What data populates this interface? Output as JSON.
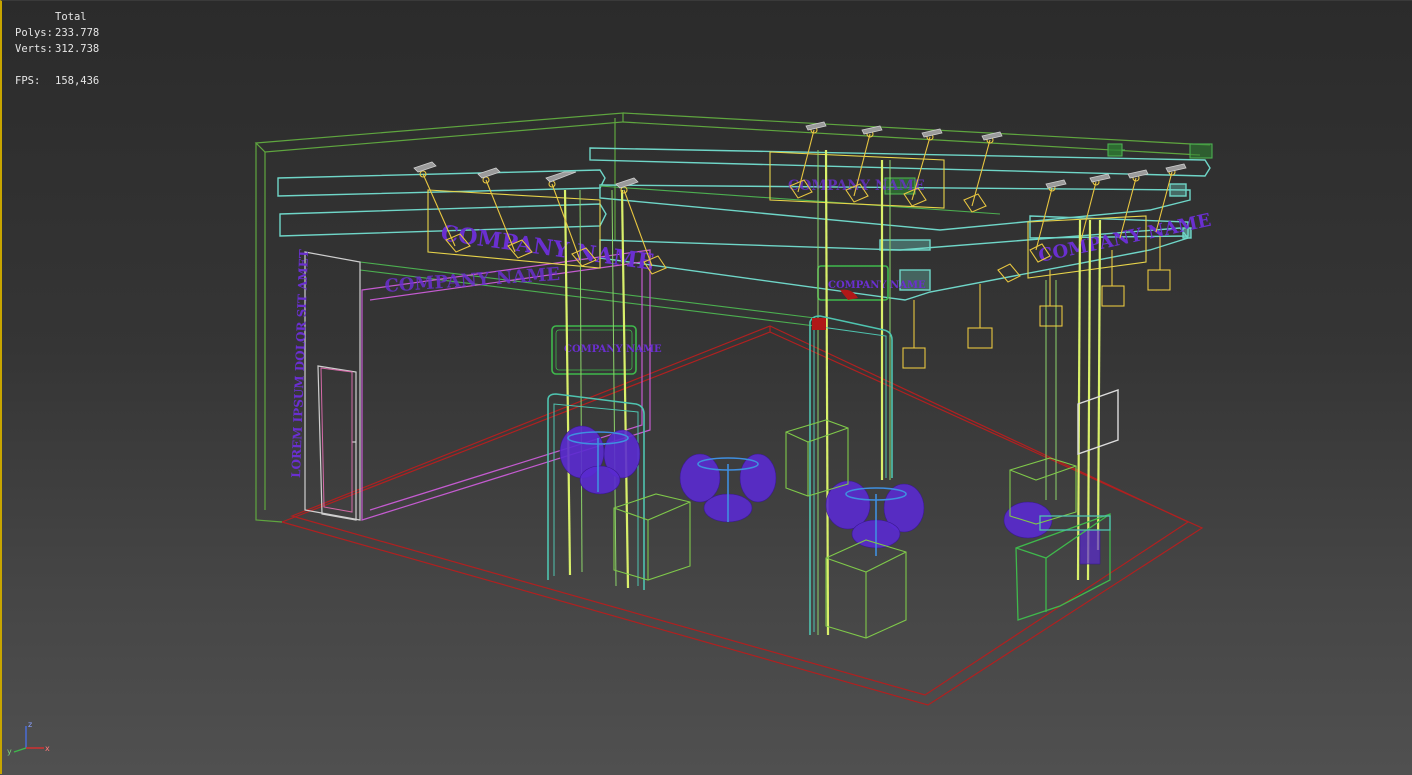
{
  "stats": {
    "header": "Total",
    "polys_label": "Polys:",
    "polys_value": "233.778",
    "verts_label": "Verts:",
    "verts_value": "312.738",
    "fps_label": "FPS:",
    "fps_value": "158,436"
  },
  "scene": {
    "sign_main": "COMPANY NAME",
    "sign_main_2": "COMPANY NAME",
    "sign_top": "COMPANY NAME",
    "sign_right": "COMPANY NAME",
    "sign_small": "COMPANY NAME",
    "sign_column": "COMPANY NAME",
    "wall_vertical": "LOREM IPSUM DOLOR SIT AMET"
  },
  "gizmo": {
    "z": "z",
    "x": "x",
    "y": "y"
  },
  "colors": {
    "background_top": "#2b2b2b",
    "background_bottom": "#505050",
    "wire_green": "#57b84a",
    "wire_cyan": "#6fd6c8",
    "wire_yellow": "#e8d44a",
    "floor_red": "#b02020",
    "purple": "#6a2fd0",
    "active_border": "#c7a500"
  }
}
